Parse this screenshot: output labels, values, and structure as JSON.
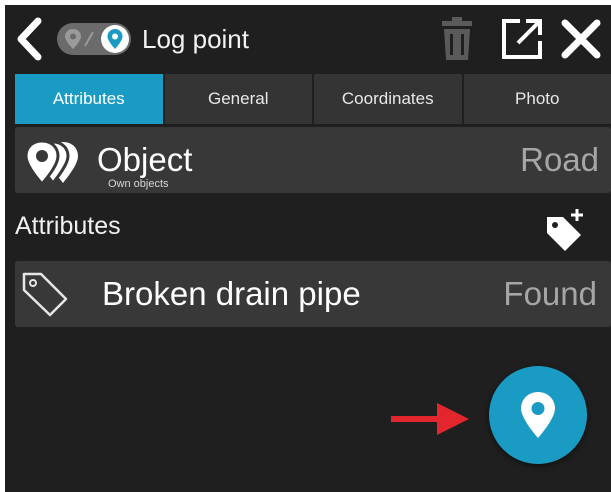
{
  "header": {
    "title": "Log point",
    "back_icon": "chevron-left-icon",
    "logging_toggle_icons": [
      "map-pin-off-icon",
      "map-pin-icon"
    ],
    "trash_icon": "trash-icon",
    "open_icon": "open-external-icon",
    "close_icon": "close-icon"
  },
  "tabs": [
    {
      "label": "Attributes",
      "active": true
    },
    {
      "label": "General",
      "active": false
    },
    {
      "label": "Coordinates",
      "active": false
    },
    {
      "label": "Photo",
      "active": false
    }
  ],
  "object": {
    "title": "Object",
    "subtitle": "Own objects",
    "value": "Road",
    "icon": "stacked-pins-icon"
  },
  "attributes_section": {
    "title": "Attributes",
    "add_icon": "add-tag-icon",
    "items": [
      {
        "name": "Broken drain pipe",
        "value": "Found",
        "icon": "tag-icon"
      }
    ]
  },
  "fab": {
    "icon": "map-pin-icon"
  },
  "annotation": {
    "arrow_icon": "red-arrow-icon"
  },
  "colors": {
    "accent": "#1a9bc4",
    "background": "#1f1f1f",
    "row": "#383838",
    "tab": "#343434",
    "annotation": "#e3262e"
  }
}
